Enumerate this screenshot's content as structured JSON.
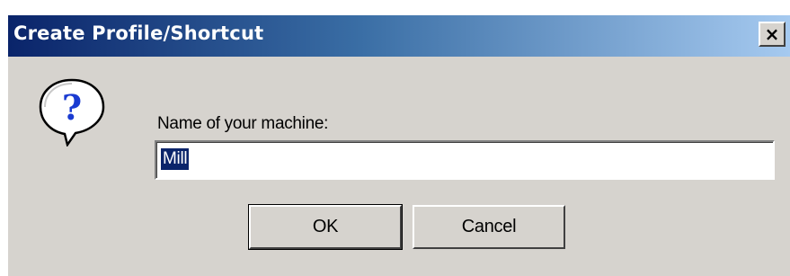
{
  "window": {
    "title": "Create Profile/Shortcut",
    "close_label": "×"
  },
  "dialog": {
    "icon": "question-icon",
    "prompt": "Name of your machine:",
    "input_value": "Mill"
  },
  "buttons": {
    "ok_label": "OK",
    "cancel_label": "Cancel"
  },
  "colors": {
    "titlebar_start": "#0a246a",
    "titlebar_end": "#a6caf0",
    "dialog_background": "#d6d3ce",
    "selection_highlight": "#0a246a"
  }
}
